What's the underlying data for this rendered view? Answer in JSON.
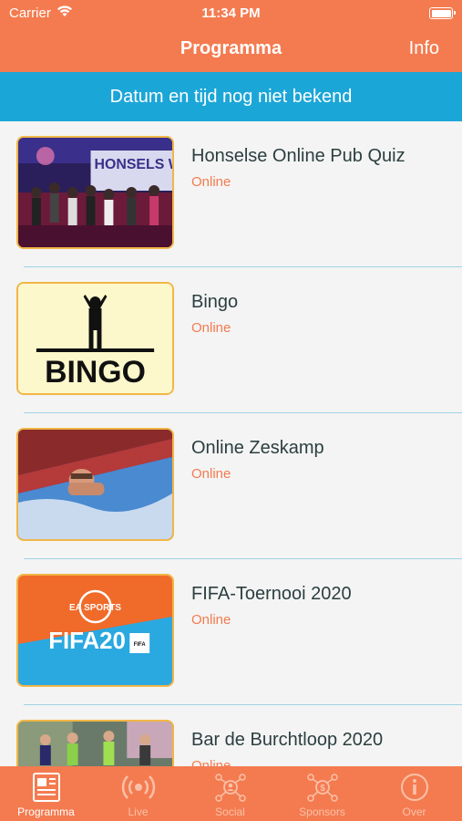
{
  "status_bar": {
    "carrier": "Carrier",
    "time": "11:34 PM"
  },
  "nav": {
    "title": "Programma",
    "info": "Info"
  },
  "banner": {
    "text": "Datum en tijd nog niet bekend"
  },
  "items": [
    {
      "name": "Honselse Online Pub Quiz",
      "status": "Online",
      "thumb_text": "HONSELS WEE"
    },
    {
      "name": "Bingo",
      "status": "Online",
      "thumb_text": "BINGO"
    },
    {
      "name": "Online Zeskamp",
      "status": "Online"
    },
    {
      "name": "FIFA-Toernooi 2020",
      "status": "Online",
      "thumb_text": "FIFA20",
      "thumb_logo": "EA SPORTS",
      "thumb_badge": "FIFA"
    },
    {
      "name": "Bar de Burchtloop 2020",
      "status": "Online"
    }
  ],
  "tabs": [
    {
      "label": "Programma",
      "icon": "newspaper-icon"
    },
    {
      "label": "Live",
      "icon": "broadcast-icon"
    },
    {
      "label": "Social",
      "icon": "social-network-icon"
    },
    {
      "label": "Sponsors",
      "icon": "sponsors-network-icon"
    },
    {
      "label": "Over",
      "icon": "info-icon"
    }
  ],
  "colors": {
    "primary": "#f47b50",
    "banner": "#1ba6d8",
    "status_text": "#f47b50",
    "thumb_border": "#f1b646"
  }
}
